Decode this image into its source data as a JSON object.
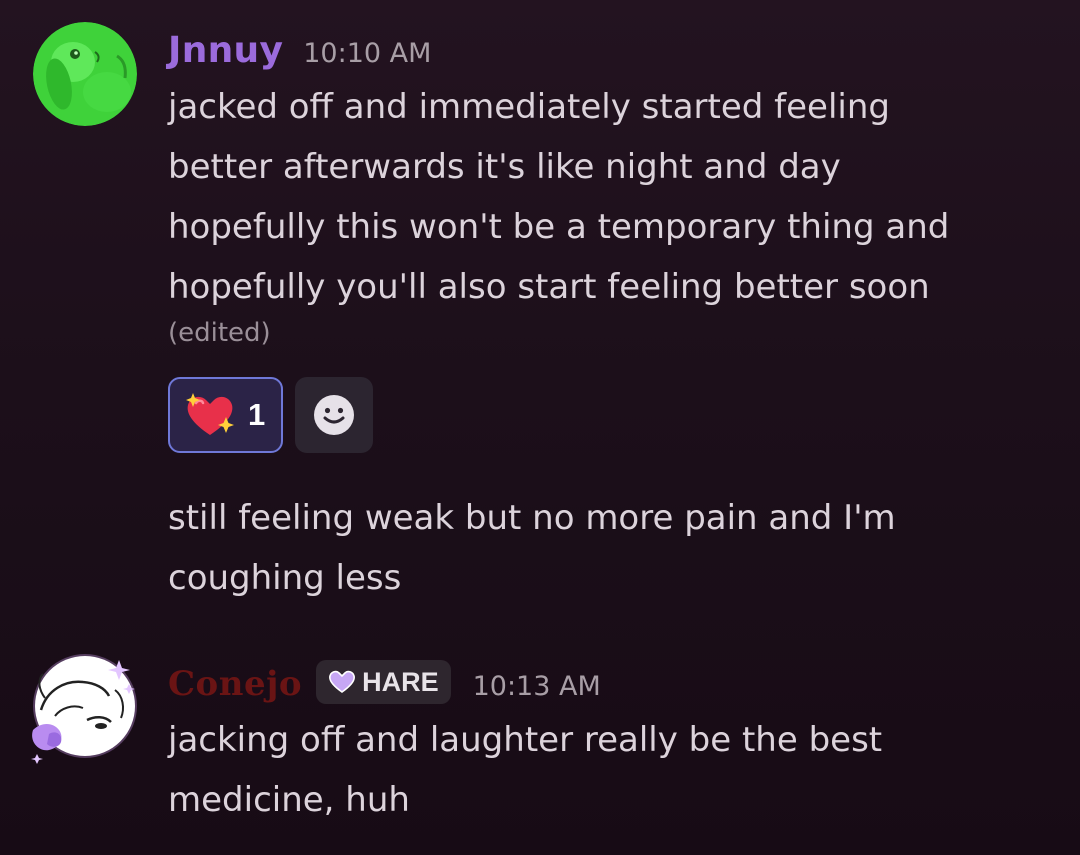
{
  "messages": [
    {
      "author": "Jnnuy",
      "author_color": "#9b6bdc",
      "time": "10:10 AM",
      "lines": [
        "jacked off and immediately started feeling",
        "better afterwards it's like night and day",
        "hopefully this won't be a temporary thing and",
        "hopefully you'll also start feeling better soon"
      ],
      "edited_label": "(edited)",
      "reactions": [
        {
          "emoji": "sparkling-heart-icon",
          "count": "1",
          "active": true
        }
      ],
      "add_reaction_icon": "add-reaction-smiley-icon"
    },
    {
      "author": "Jnnuy",
      "continuation": true,
      "lines": [
        "still feeling weak but no more pain and I'm",
        "coughing less"
      ]
    },
    {
      "author": "Conejo",
      "author_color": "#6a1414",
      "badge": {
        "icon": "purple-heart-icon",
        "label": "HARE"
      },
      "time": "10:13 AM",
      "lines": [
        "jacking off and laughter really be the best",
        "medicine, huh"
      ]
    }
  ]
}
